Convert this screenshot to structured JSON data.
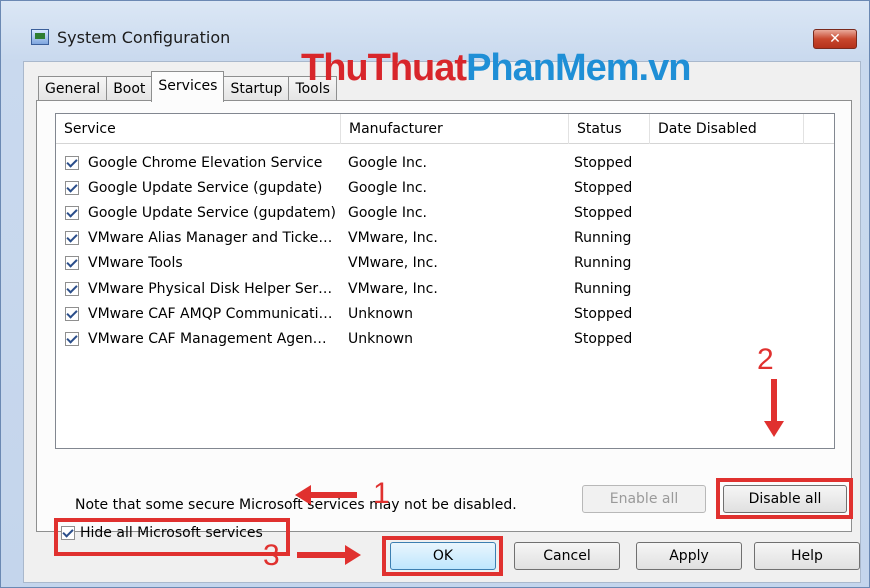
{
  "window": {
    "title": "System Configuration",
    "close_label": "✕"
  },
  "tabs": [
    {
      "label": "General"
    },
    {
      "label": "Boot"
    },
    {
      "label": "Services"
    },
    {
      "label": "Startup"
    },
    {
      "label": "Tools"
    }
  ],
  "table": {
    "columns": [
      "Service",
      "Manufacturer",
      "Status",
      "Date Disabled"
    ],
    "rows": [
      {
        "service": "Google Chrome Elevation Service",
        "manufacturer": "Google Inc.",
        "status": "Stopped",
        "checked": true
      },
      {
        "service": "Google Update Service (gupdate)",
        "manufacturer": "Google Inc.",
        "status": "Stopped",
        "checked": true
      },
      {
        "service": "Google Update Service (gupdatem)",
        "manufacturer": "Google Inc.",
        "status": "Stopped",
        "checked": true
      },
      {
        "service": "VMware Alias Manager and Ticke…",
        "manufacturer": "VMware, Inc.",
        "status": "Running",
        "checked": true
      },
      {
        "service": "VMware Tools",
        "manufacturer": "VMware, Inc.",
        "status": "Running",
        "checked": true
      },
      {
        "service": "VMware Physical Disk Helper Ser…",
        "manufacturer": "VMware, Inc.",
        "status": "Running",
        "checked": true
      },
      {
        "service": "VMware CAF AMQP Communicati…",
        "manufacturer": "Unknown",
        "status": "Stopped",
        "checked": true
      },
      {
        "service": "VMware CAF Management Agen…",
        "manufacturer": "Unknown",
        "status": "Stopped",
        "checked": true
      }
    ]
  },
  "watermark": {
    "part1": "ThuThuat",
    "part2": "PhanMem.vn"
  },
  "note": "Note that some secure Microsoft services may not be disabled.",
  "buttons": {
    "enable_all": "Enable all",
    "disable_all": "Disable all",
    "ok": "OK",
    "cancel": "Cancel",
    "apply": "Apply",
    "help": "Help"
  },
  "hide_ms": {
    "label": "Hide all Microsoft services",
    "checked": true
  },
  "annotations": {
    "n1": "1",
    "n2": "2",
    "n3": "3",
    "color": "#e0312f"
  }
}
